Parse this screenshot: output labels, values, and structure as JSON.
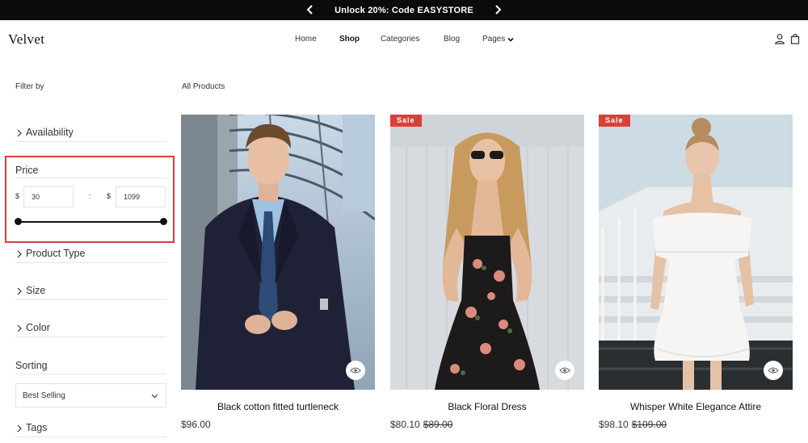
{
  "announcement": {
    "text": "Unlock 20%: Code EASYSTORE"
  },
  "header": {
    "logo": "Velvet",
    "nav": {
      "home": "Home",
      "shop": "Shop",
      "categories": "Categories",
      "blog": "Blog",
      "pages": "Pages"
    }
  },
  "sidebar": {
    "filter_by": "Filter by",
    "facets": {
      "availability": "Availability",
      "product_type": "Product Type",
      "size": "Size",
      "color": "Color",
      "tags": "Tags"
    },
    "price": {
      "title": "Price",
      "currency": "$",
      "min": "30",
      "max": "1099",
      "separator": ":",
      "slider_min_fraction": 0,
      "slider_max_fraction": 1
    },
    "sorting": {
      "title": "Sorting",
      "selected": "Best Selling"
    }
  },
  "main": {
    "heading": "All Products",
    "products": [
      {
        "name": "Black cotton fitted turtleneck",
        "price": "$96.00",
        "compare_price": "",
        "badge": ""
      },
      {
        "name": "Black Floral Dress",
        "price": "$80.10",
        "compare_price": "$89.00",
        "badge": "Sale"
      },
      {
        "name": "Whisper White Elegance Attire",
        "price": "$98.10",
        "compare_price": "$109.00",
        "badge": "Sale"
      }
    ]
  },
  "colors": {
    "accent": "#d9403a",
    "announcement_bg": "#0b0b0b",
    "text": "#222222"
  }
}
